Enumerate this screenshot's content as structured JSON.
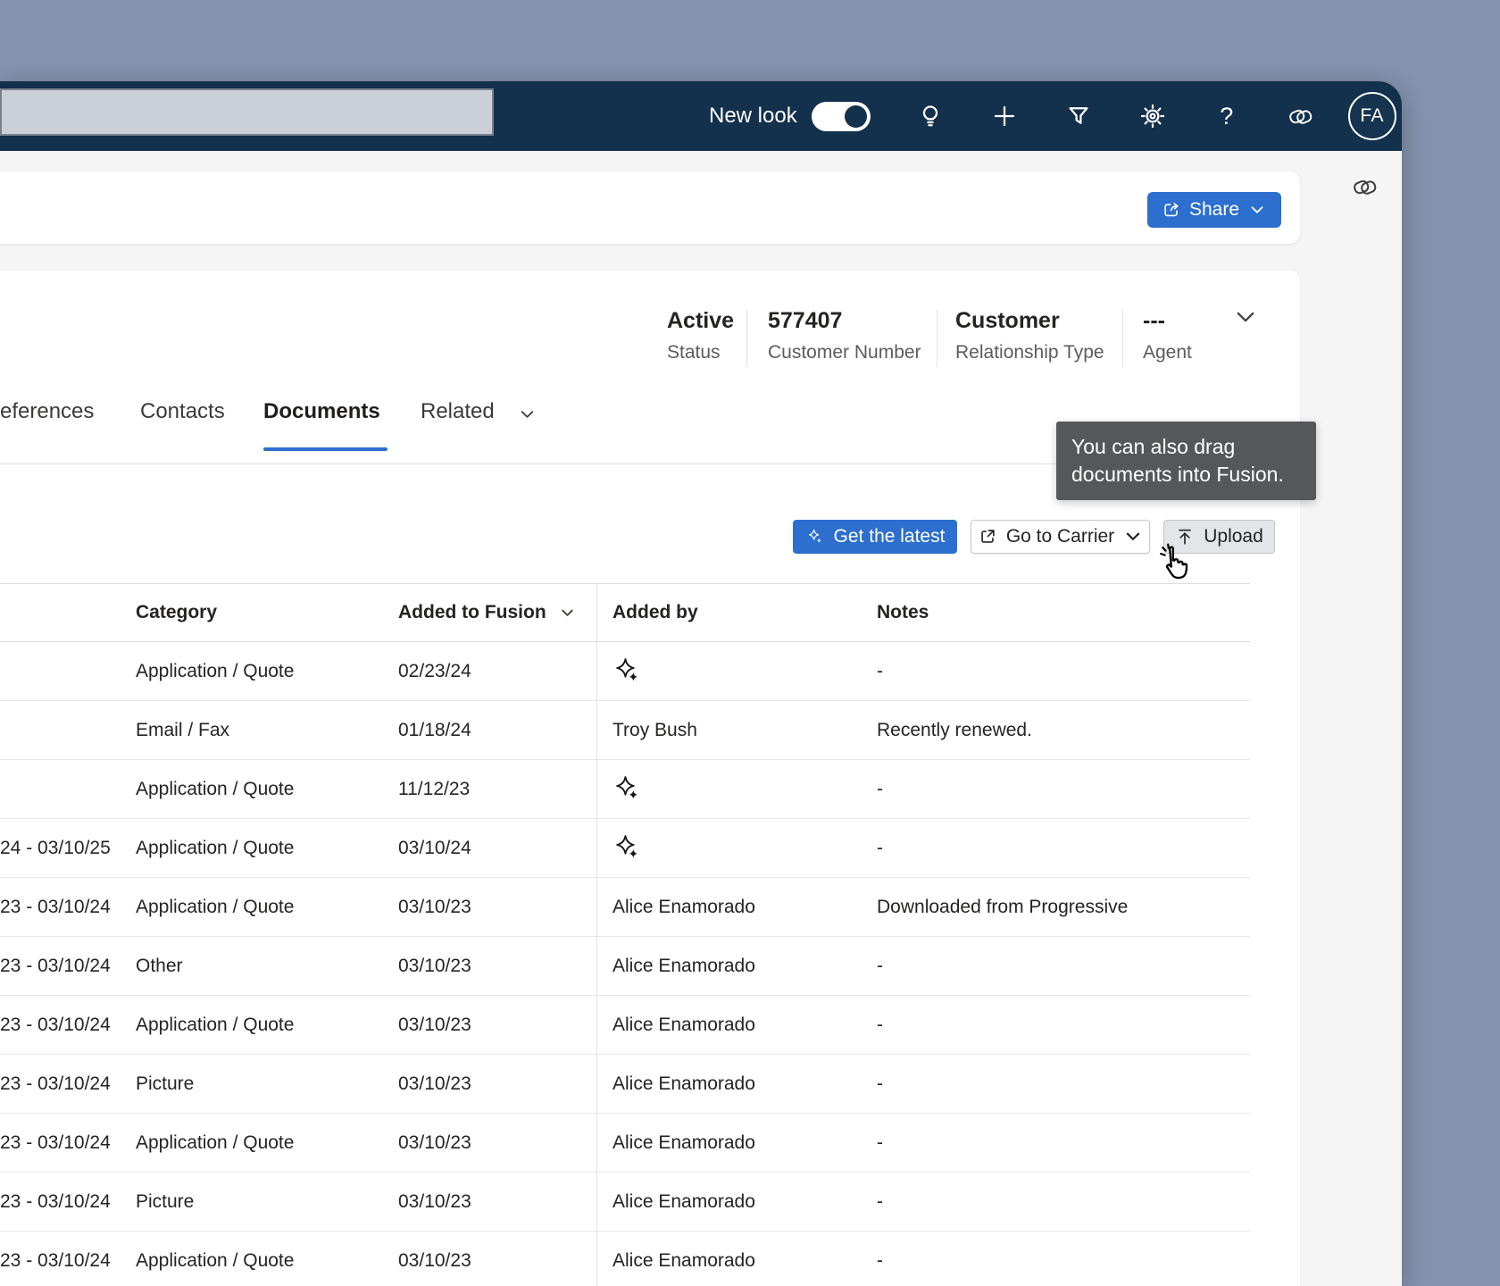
{
  "topbar": {
    "new_look_label": "New look",
    "new_look_toggle": "on",
    "icons": [
      "lightbulb",
      "add",
      "filter",
      "settings",
      "help",
      "copilot"
    ],
    "help_glyph": "?",
    "avatar_initials": "FA"
  },
  "share_card": {
    "share_label": "Share"
  },
  "customer_card": {
    "fields": [
      {
        "value": "Active",
        "label": "Status"
      },
      {
        "value": "577407",
        "label": "Customer Number"
      },
      {
        "value": "Customer",
        "label": "Relationship Type"
      },
      {
        "value": "---",
        "label": "Agent"
      }
    ]
  },
  "tabs": {
    "items": [
      {
        "label": "eferences",
        "active": false
      },
      {
        "label": "Contacts",
        "active": false
      },
      {
        "label": "Documents",
        "active": true
      },
      {
        "label": "Related",
        "active": false
      }
    ]
  },
  "tooltip": {
    "text": "You can also drag documents into Fusion."
  },
  "actions": {
    "get_latest_label": "Get the latest",
    "go_to_carrier_label": "Go to Carrier",
    "upload_label": "Upload"
  },
  "right_rail": {
    "icons": [
      "copilot"
    ]
  },
  "table": {
    "columns": [
      "Category",
      "Added to Fusion",
      "Added by",
      "Notes"
    ],
    "sorted_column": "Added to Fusion",
    "rows": [
      {
        "date_range": "",
        "category": "Application / Quote",
        "added_to_fusion": "02/23/24",
        "added_by": "",
        "added_by_icon": "sparkle",
        "notes": "-"
      },
      {
        "date_range": "",
        "category": "Email / Fax",
        "added_to_fusion": "01/18/24",
        "added_by": "Troy Bush",
        "added_by_icon": "",
        "notes": "Recently renewed."
      },
      {
        "date_range": "",
        "category": "Application / Quote",
        "added_to_fusion": "11/12/23",
        "added_by": "",
        "added_by_icon": "sparkle",
        "notes": "-"
      },
      {
        "date_range": "24 - 03/10/25",
        "category": "Application / Quote",
        "added_to_fusion": "03/10/24",
        "added_by": "",
        "added_by_icon": "sparkle",
        "notes": "-"
      },
      {
        "date_range": "23 - 03/10/24",
        "category": "Application / Quote",
        "added_to_fusion": "03/10/23",
        "added_by": "Alice Enamorado",
        "added_by_icon": "",
        "notes": "Downloaded from Progressive"
      },
      {
        "date_range": "23 - 03/10/24",
        "category": "Other",
        "added_to_fusion": "03/10/23",
        "added_by": "Alice Enamorado",
        "added_by_icon": "",
        "notes": "-"
      },
      {
        "date_range": "23 - 03/10/24",
        "category": "Application / Quote",
        "added_to_fusion": "03/10/23",
        "added_by": "Alice Enamorado",
        "added_by_icon": "",
        "notes": "-"
      },
      {
        "date_range": "23 - 03/10/24",
        "category": "Picture",
        "added_to_fusion": "03/10/23",
        "added_by": "Alice Enamorado",
        "added_by_icon": "",
        "notes": "-"
      },
      {
        "date_range": "23 - 03/10/24",
        "category": "Application / Quote",
        "added_to_fusion": "03/10/23",
        "added_by": "Alice Enamorado",
        "added_by_icon": "",
        "notes": "-"
      },
      {
        "date_range": "23 - 03/10/24",
        "category": "Picture",
        "added_to_fusion": "03/10/23",
        "added_by": "Alice Enamorado",
        "added_by_icon": "",
        "notes": "-"
      },
      {
        "date_range": "23 - 03/10/24",
        "category": "Application / Quote",
        "added_to_fusion": "03/10/23",
        "added_by": "Alice Enamorado",
        "added_by_icon": "",
        "notes": "-"
      }
    ]
  },
  "colors": {
    "accent_blue": "#2D6FCE",
    "topbar_navy": "#13304C",
    "desktop_slate": "#8493AE",
    "tooltip_gray": "#565759"
  }
}
